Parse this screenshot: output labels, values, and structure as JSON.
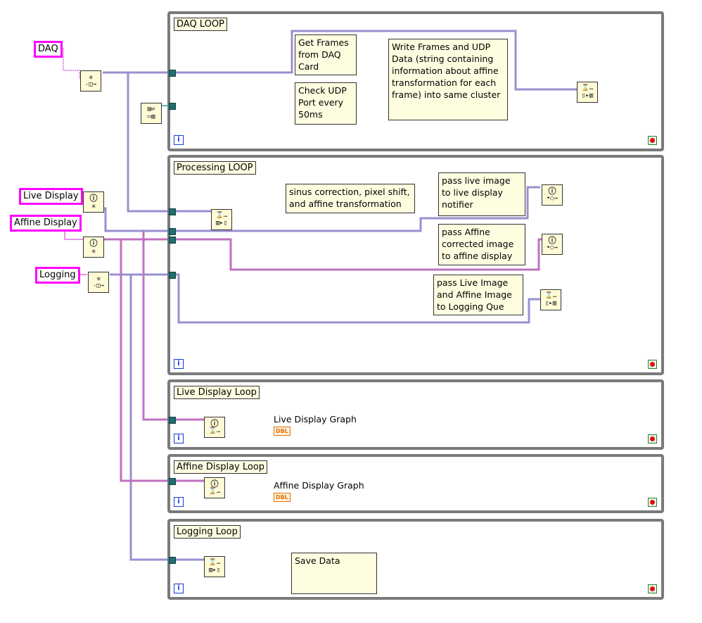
{
  "loops": {
    "daq": {
      "label": "DAQ LOOP"
    },
    "processing": {
      "label": "Processing LOOP"
    },
    "live": {
      "label": "Live Display Loop"
    },
    "affine": {
      "label": "Affine Display Loop"
    },
    "logging": {
      "label": "Logging Loop"
    }
  },
  "iteration_symbol": "i",
  "controls": {
    "daq": "DAQ",
    "live_display": "Live Display",
    "affine_display": "Affine Display",
    "logging": "Logging"
  },
  "notes": {
    "get_frames": "Get Frames from DAQ Card",
    "check_udp": "Check UDP Port every 50ms",
    "write_frames": "Write Frames and UDP Data (string containing information about affine transformation for each frame) into same cluster",
    "sinus_correction": "sinus correction, pixel shift, and affine transformation",
    "pass_live": "pass live image to live display notifier",
    "pass_affine": "pass Affine corrected image to affine display",
    "pass_logging": "pass Live Image and Affine Image to Logging Que",
    "save_data": "Save Data"
  },
  "indicators": {
    "live_graph": "Live Display Graph",
    "affine_graph": "Affine Display Graph",
    "terminal_tag": "DBL"
  },
  "colors": {
    "loop_border": "#7a7a7a",
    "wire_queue": "#9a8fd0",
    "wire_notifier": "#c070c0",
    "control_border": "#ff00ff",
    "stop_red": "#e01010"
  }
}
